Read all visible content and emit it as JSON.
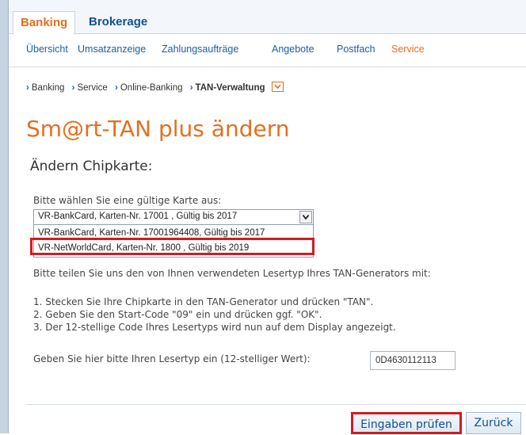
{
  "tabs": [
    {
      "label": "Banking",
      "active": true
    },
    {
      "label": "Brokerage",
      "active": false
    }
  ],
  "subnav": [
    {
      "label": "Übersicht"
    },
    {
      "label": "Umsatzanzeige"
    },
    {
      "label": "Zahlungsaufträge"
    },
    {
      "label": "Angebote"
    },
    {
      "label": "Postfach"
    },
    {
      "label": "Service",
      "active": true
    }
  ],
  "breadcrumb": [
    "Banking",
    "Service",
    "Online-Banking",
    "TAN-Verwaltung"
  ],
  "page_title": "Sm@rt-TAN plus ändern",
  "section_title": "Ändern Chipkarte:",
  "card_select": {
    "label": "Bitte wählen Sie eine gültige Karte aus:",
    "selected": "VR-BankCard, Karten-Nr. 17001          , Gültig bis 2017",
    "options": [
      "VR-BankCard, Karten-Nr. 17001964408, Gültig bis 2017",
      "VR-NetWorldCard, Karten-Nr. 1800            , Gültig bis 2019"
    ]
  },
  "instructions": {
    "intro": "Bitte teilen Sie uns den von Ihnen verwendeten Lesertyp Ihres TAN-Generators mit:",
    "steps": [
      "1. Stecken Sie Ihre Chipkarte in den TAN-Generator und drücken \"TAN\".",
      "2. Geben Sie den Start-Code \"09\" ein und drücken ggf. \"OK\".",
      "3. Der 12-stellige Code Ihres Lesertyps wird nun auf dem Display angezeigt."
    ]
  },
  "lesertyp": {
    "label": "Geben Sie hier bitte Ihren Lesertyp ein (12-stelliger Wert):",
    "value": "0D4630112113"
  },
  "buttons": {
    "check": "Eingaben prüfen",
    "back": "Zurück"
  },
  "colors": {
    "accent": "#e56f1f",
    "link": "#1b5ea4",
    "highlight": "#d21b22"
  }
}
